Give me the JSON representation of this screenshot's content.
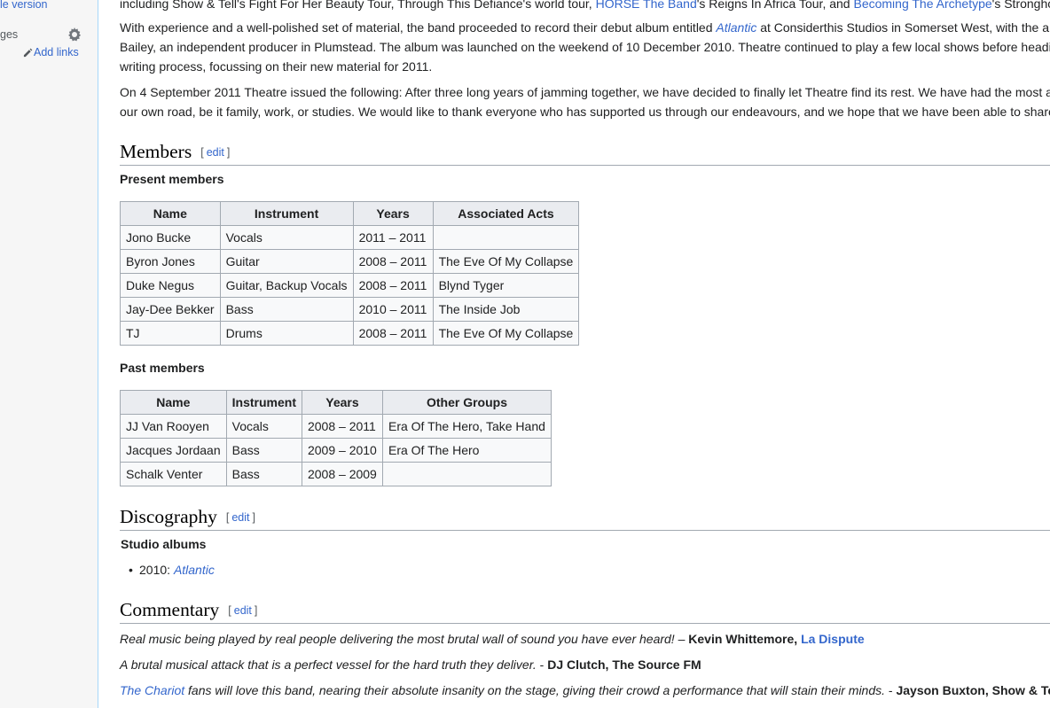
{
  "sidebar": {
    "mobile_version": "le version",
    "languages": "ges",
    "add_links": "Add links"
  },
  "intro": {
    "line0_pre": "including Show & Tell's Fight For Her Beauty Tour, Through This Defiance's world tour, ",
    "line0_link1": "HORSE The Band",
    "line0_mid": "'s Reigns In Africa Tour, and ",
    "line0_link2": "Becoming The Archetype",
    "line0_post": "'s Stronghold",
    "p2_a_pre": "With experience and a well-polished set of material, the band proceeded to record their debut album entitled ",
    "p2_a_link": "Atlantic",
    "p2_a_post": " at Considerthis Studios in Somerset West, with the a",
    "p2_b": "Bailey, an independent producer in Plumstead. The album was launched on the weekend of 10 December 2010. Theatre continued to play a few local shows before headi",
    "p2_c": "writing process, focussing on their new material for 2011.",
    "p3_a": "On 4 September 2011 Theatre issued the following: After three long years of jamming together, we have decided to finally let Theatre find its rest. We have had the most a",
    "p3_b": "our own road, be it family, work, or studies. We would like to thank everyone who has supported us through our endeavours, and we hope that we have been able to share"
  },
  "members": {
    "heading": "Members",
    "edit_open": "[ ",
    "edit_label": "edit",
    "edit_close": " ]",
    "present_title": "Present members",
    "present_headers": [
      "Name",
      "Instrument",
      "Years",
      "Associated Acts"
    ],
    "present_rows": [
      [
        "Jono Bucke",
        "Vocals",
        "2011 – 2011",
        ""
      ],
      [
        "Byron Jones",
        "Guitar",
        "2008 – 2011",
        "The Eve Of My Collapse"
      ],
      [
        "Duke Negus",
        "Guitar, Backup Vocals",
        "2008 – 2011",
        "Blynd Tyger"
      ],
      [
        "Jay-Dee Bekker",
        "Bass",
        "2010 – 2011",
        "The Inside Job"
      ],
      [
        "TJ",
        "Drums",
        "2008 – 2011",
        "The Eve Of My Collapse"
      ]
    ],
    "past_title": "Past members",
    "past_headers": [
      "Name",
      "Instrument",
      "Years",
      "Other Groups"
    ],
    "past_rows": [
      [
        "JJ Van Rooyen",
        "Vocals",
        "2008 – 2011",
        "Era Of The Hero, Take Hand"
      ],
      [
        "Jacques Jordaan",
        "Bass",
        "2009 – 2010",
        "Era Of The Hero"
      ],
      [
        "Schalk Venter",
        "Bass",
        "2008 – 2009",
        ""
      ]
    ]
  },
  "discography": {
    "heading": "Discography",
    "edit_label": "edit",
    "studio_title": "Studio albums",
    "item_year": "2010: ",
    "item_album": "Atlantic"
  },
  "commentary": {
    "heading": "Commentary",
    "edit_label": "edit",
    "q1_text": "Real music being played by real people delivering the most brutal wall of sound you have ever heard!",
    "q1_sep": " – ",
    "q1_author": "Kevin Whittemore, ",
    "q1_link": "La Dispute",
    "q2_text": "A brutal musical attack that is a perfect vessel for the hard truth they deliver.",
    "q2_sep": " - ",
    "q2_author": "DJ Clutch, The Source FM",
    "q3_link": "The Chariot",
    "q3_text": " fans will love this band, nearing their absolute insanity on the stage, giving their crowd a performance that will stain their minds.",
    "q3_sep": " - ",
    "q3_author": "Jayson Buxton, Show & Te"
  },
  "colors": {
    "link": "#3366cc",
    "border": "#a2a9b1",
    "header_bg": "#eaecf0",
    "table_bg": "#f8f9fa"
  }
}
